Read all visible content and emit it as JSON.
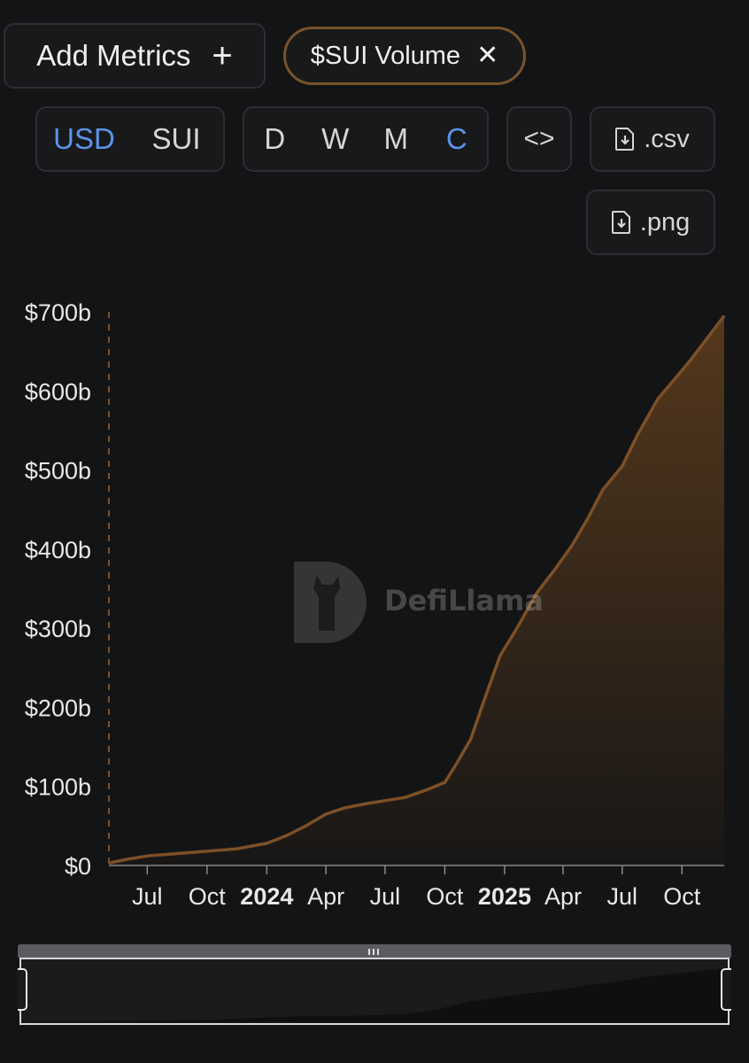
{
  "toolbar": {
    "add_metrics_label": "Add Metrics",
    "add_icon": "+",
    "metric_chip_label": "$SUI Volume",
    "close_icon": "✕",
    "denomination": {
      "options": [
        "USD",
        "SUI"
      ],
      "selected": "USD"
    },
    "period": {
      "options": [
        "D",
        "W",
        "M",
        "C"
      ],
      "selected": "C"
    },
    "embed_icon": "<>",
    "csv_label": ".csv",
    "png_label": ".png"
  },
  "watermark": {
    "text": "DefiLlama"
  },
  "colors": {
    "background": "#131415",
    "series_line": "#7d5027",
    "series_fill": "#6b4420",
    "active": "#5b93e8"
  },
  "chart_data": {
    "type": "area",
    "title": "",
    "xlabel": "",
    "ylabel": "",
    "ylim": [
      0,
      700
    ],
    "y_unit": "billions USD",
    "y_ticks": [
      "$0",
      "$100b",
      "$200b",
      "$300b",
      "$400b",
      "$500b",
      "$600b",
      "$700b"
    ],
    "x_ticks": [
      {
        "label": "Jul",
        "date": "2023-07-01",
        "bold": false
      },
      {
        "label": "Oct",
        "date": "2023-10-01",
        "bold": false
      },
      {
        "label": "2024",
        "date": "2024-01-01",
        "bold": true
      },
      {
        "label": "Apr",
        "date": "2024-04-01",
        "bold": false
      },
      {
        "label": "Jul",
        "date": "2024-07-01",
        "bold": false
      },
      {
        "label": "Oct",
        "date": "2024-10-01",
        "bold": false
      },
      {
        "label": "2025",
        "date": "2025-01-01",
        "bold": true
      },
      {
        "label": "Apr",
        "date": "2025-04-01",
        "bold": false
      },
      {
        "label": "Jul",
        "date": "2025-07-01",
        "bold": false
      },
      {
        "label": "Oct",
        "date": "2025-10-01",
        "bold": false
      }
    ],
    "xlim": [
      "2023-05-03",
      "2025-12-05"
    ],
    "series": [
      {
        "name": "$SUI Volume",
        "cumulative": true,
        "points": [
          {
            "x": "2023-05-03",
            "y": 3
          },
          {
            "x": "2023-06-01",
            "y": 8
          },
          {
            "x": "2023-07-01",
            "y": 12
          },
          {
            "x": "2023-08-15",
            "y": 15
          },
          {
            "x": "2023-10-01",
            "y": 18
          },
          {
            "x": "2023-11-15",
            "y": 21
          },
          {
            "x": "2024-01-01",
            "y": 28
          },
          {
            "x": "2024-02-01",
            "y": 38
          },
          {
            "x": "2024-03-01",
            "y": 50
          },
          {
            "x": "2024-04-01",
            "y": 65
          },
          {
            "x": "2024-05-01",
            "y": 73
          },
          {
            "x": "2024-06-01",
            "y": 78
          },
          {
            "x": "2024-07-01",
            "y": 82
          },
          {
            "x": "2024-08-01",
            "y": 86
          },
          {
            "x": "2024-09-01",
            "y": 95
          },
          {
            "x": "2024-10-01",
            "y": 105
          },
          {
            "x": "2024-10-20",
            "y": 130
          },
          {
            "x": "2024-11-10",
            "y": 160
          },
          {
            "x": "2024-12-01",
            "y": 210
          },
          {
            "x": "2024-12-25",
            "y": 265
          },
          {
            "x": "2025-01-20",
            "y": 300
          },
          {
            "x": "2025-02-20",
            "y": 345
          },
          {
            "x": "2025-03-20",
            "y": 375
          },
          {
            "x": "2025-04-15",
            "y": 405
          },
          {
            "x": "2025-05-10",
            "y": 440
          },
          {
            "x": "2025-06-01",
            "y": 475
          },
          {
            "x": "2025-07-01",
            "y": 505
          },
          {
            "x": "2025-07-25",
            "y": 545
          },
          {
            "x": "2025-08-25",
            "y": 590
          },
          {
            "x": "2025-09-20",
            "y": 615
          },
          {
            "x": "2025-10-15",
            "y": 640
          },
          {
            "x": "2025-11-10",
            "y": 668
          },
          {
            "x": "2025-12-05",
            "y": 695
          }
        ]
      }
    ],
    "grid": false,
    "legend": "none"
  }
}
